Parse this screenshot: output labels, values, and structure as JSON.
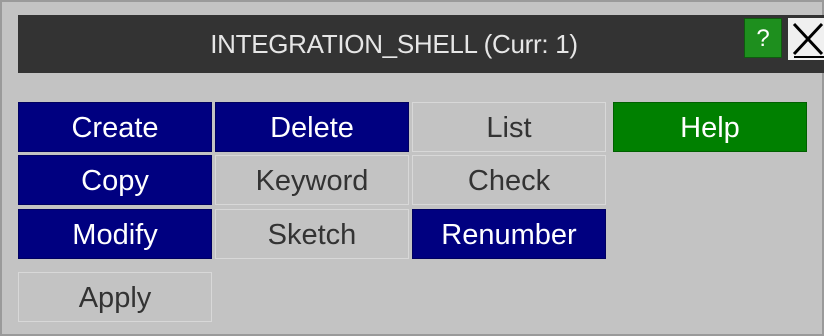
{
  "window": {
    "title": "INTEGRATION_SHELL (Curr: 1)",
    "help_icon_label": "?",
    "close_icon": "close-icon"
  },
  "buttons": {
    "create": "Create",
    "delete": "Delete",
    "list": "List",
    "help": "Help",
    "copy": "Copy",
    "keyword": "Keyword",
    "check": "Check",
    "modify": "Modify",
    "sketch": "Sketch",
    "renumber": "Renumber",
    "apply": "Apply"
  },
  "colors": {
    "panel_bg": "#c3c3c3",
    "titlebar_bg": "#333333",
    "active_blue": "#000080",
    "help_green": "#008000"
  }
}
